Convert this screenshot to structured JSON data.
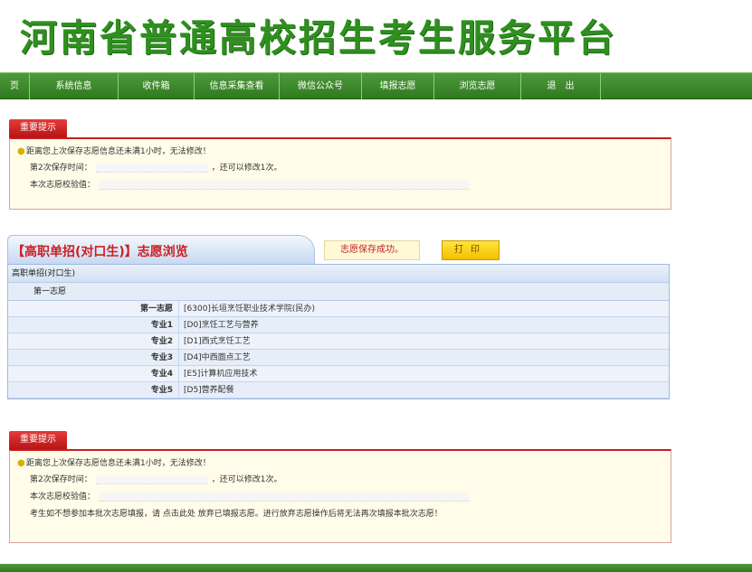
{
  "site": {
    "title": "河南省普通高校招生考生服务平台"
  },
  "nav": {
    "items": [
      {
        "label": "页"
      },
      {
        "label": "系统信息"
      },
      {
        "label": "收件箱"
      },
      {
        "label": "信息采集查看"
      },
      {
        "label": "微信公众号"
      },
      {
        "label": "填报志愿"
      },
      {
        "label": "浏览志愿"
      },
      {
        "label": "退　出"
      }
    ]
  },
  "notice_top": {
    "tab": "重要提示",
    "line1": "距离您上次保存志愿信息还未满1小时，无法修改！",
    "line2_prefix": "第2次保存时间：",
    "line2_suffix": "，还可以修改1次。",
    "line3_prefix": "本次志愿校验值："
  },
  "browse": {
    "title": "【高职单招(对口生)】志愿浏览",
    "save_success": "志愿保存成功。",
    "print_label": "打印",
    "category": "高职单招(对口生)",
    "group": "第一志愿",
    "rows": [
      {
        "label": "第一志愿",
        "value": "[6300]长垣烹饪职业技术学院(民办)"
      },
      {
        "label": "专业1",
        "value": "[D0]烹饪工艺与营养"
      },
      {
        "label": "专业2",
        "value": "[D1]西式烹饪工艺"
      },
      {
        "label": "专业3",
        "value": "[D4]中西面点工艺"
      },
      {
        "label": "专业4",
        "value": "[E5]计算机应用技术"
      },
      {
        "label": "专业5",
        "value": "[D5]营养配餐"
      }
    ]
  },
  "notice_bottom": {
    "tab": "重要提示",
    "line1": "距离您上次保存志愿信息还未满1小时，无法修改！",
    "line2_prefix": "第2次保存时间：",
    "line2_suffix": "，还可以修改1次。",
    "line3_prefix": "本次志愿校验值：",
    "line4": "考生如不想参加本批次志愿填报，请 点击此处 放弃已填报志愿。进行放弃志愿操作后将无法再次填报本批次志愿！"
  },
  "colors": {
    "brand_green": "#2f8f1f",
    "alert_red": "#c91d1d",
    "table_blue": "#d3e1f3"
  }
}
